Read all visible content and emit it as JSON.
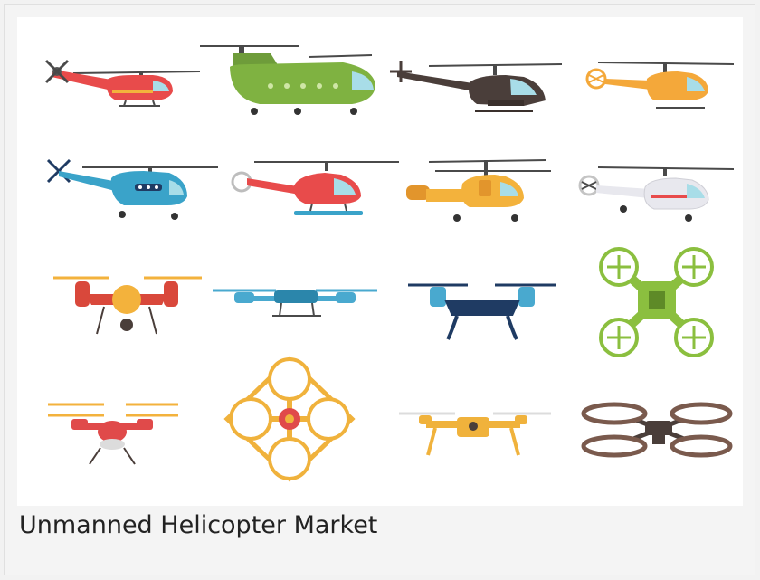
{
  "caption": "Unmanned Helicopter Market",
  "colors": {
    "background": "#f4f4f4",
    "image_background": "#ffffff",
    "caption_text": "#222222"
  },
  "illustrations": [
    {
      "name": "red-helicopter-icon",
      "kind": "helicopter",
      "color": "#e84b4b"
    },
    {
      "name": "green-tandem-rotor-helicopter-icon",
      "kind": "tandem-helicopter",
      "color": "#7fb241"
    },
    {
      "name": "dark-attack-helicopter-icon",
      "kind": "attack-helicopter",
      "color": "#4a3e3a"
    },
    {
      "name": "orange-helicopter-icon",
      "kind": "helicopter",
      "color": "#f4a83a"
    },
    {
      "name": "blue-helicopter-icon",
      "kind": "helicopter",
      "color": "#3aa3c9"
    },
    {
      "name": "red-float-helicopter-icon",
      "kind": "helicopter",
      "color": "#e84b4b"
    },
    {
      "name": "yellow-helicopter-icon",
      "kind": "helicopter",
      "color": "#f3b23c"
    },
    {
      "name": "white-helicopter-icon",
      "kind": "helicopter",
      "color": "#e8e8ee"
    },
    {
      "name": "red-camera-drone-icon",
      "kind": "drone",
      "color": "#d9483b"
    },
    {
      "name": "blue-drone-icon",
      "kind": "drone",
      "color": "#49a9cf"
    },
    {
      "name": "navy-drone-icon",
      "kind": "drone",
      "color": "#1f3b63"
    },
    {
      "name": "green-quadcopter-icon",
      "kind": "quadcopter",
      "color": "#8bbf3f"
    },
    {
      "name": "red-white-drone-icon",
      "kind": "drone",
      "color": "#e04a4a"
    },
    {
      "name": "gold-quadcopter-icon",
      "kind": "quadcopter",
      "color": "#f0b23c"
    },
    {
      "name": "yellow-camera-drone-icon",
      "kind": "drone",
      "color": "#f0b23c"
    },
    {
      "name": "brown-quadcopter-icon",
      "kind": "quadcopter",
      "color": "#7a5a4d"
    }
  ]
}
